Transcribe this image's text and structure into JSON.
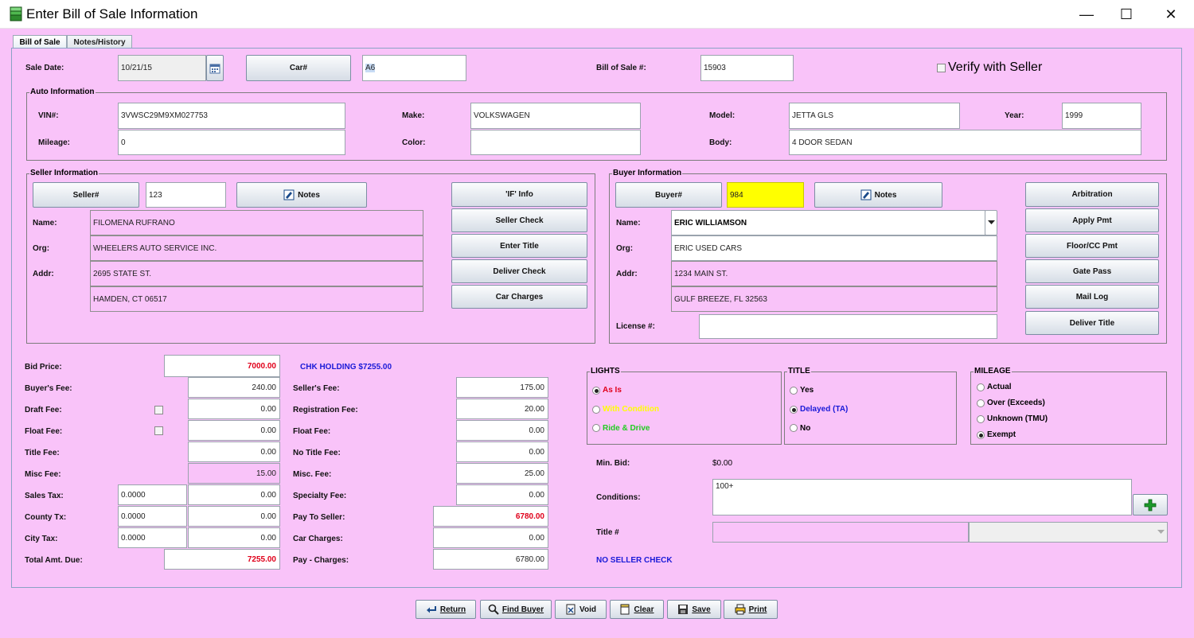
{
  "window": {
    "title": "Enter Bill of Sale Information",
    "minimize": "—",
    "maximize": "☐",
    "close": "✕"
  },
  "tabs": [
    {
      "label": "Bill of Sale"
    },
    {
      "label": "Notes/History"
    }
  ],
  "sale": {
    "date_label": "Sale Date:",
    "date": "10/21/15",
    "car_button": "Car#",
    "car_value": "A6",
    "bos_label": "Bill of Sale #:",
    "bos_value": "15903",
    "verify_label": "Verify with Seller"
  },
  "auto": {
    "title": "Auto Information",
    "vin_label": "VIN#:",
    "vin": "3VWSC29M9XM027753",
    "make_label": "Make:",
    "make": "VOLKSWAGEN",
    "model_label": "Model:",
    "model": "JETTA GLS",
    "year_label": "Year:",
    "year": "1999",
    "mileage_label": "Mileage:",
    "mileage": "0",
    "color_label": "Color:",
    "color": "",
    "body_label": "Body:",
    "body": "4 DOOR SEDAN"
  },
  "seller": {
    "title": "Seller Information",
    "button": "Seller#",
    "number": "123",
    "notes": "Notes",
    "name_label": "Name:",
    "name": "FILOMENA RUFRANO",
    "org_label": "Org:",
    "org": "WHEELERS AUTO SERVICE INC.",
    "addr_label": "Addr:",
    "addr1": "2695 STATE ST.",
    "addr2": "HAMDEN, CT 06517",
    "actions": [
      "'IF' Info",
      "Seller Check",
      "Enter Title",
      "Deliver Check",
      "Car Charges"
    ]
  },
  "buyer": {
    "title": "Buyer Information",
    "button": "Buyer#",
    "number": "984",
    "notes": "Notes",
    "name_label": "Name:",
    "name": "ERIC WILLIAMSON",
    "org_label": "Org:",
    "org": "ERIC USED CARS",
    "addr_label": "Addr:",
    "addr1": "1234 MAIN ST.",
    "addr2": "GULF BREEZE, FL 32563",
    "license_label": "License #:",
    "license": "",
    "actions": [
      "Arbitration",
      "Apply Pmt",
      "Floor/CC Pmt",
      "Gate Pass",
      "Mail Log",
      "Deliver Title"
    ]
  },
  "fees_left": {
    "bid_price_label": "Bid Price:",
    "bid_price": "7000.00",
    "chk_holding": "CHK HOLDING $7255.00",
    "buyers_fee_label": "Buyer's Fee:",
    "buyers_fee": "240.00",
    "draft_fee_label": "Draft Fee:",
    "draft_fee": "0.00",
    "float_fee_label": "Float Fee:",
    "float_fee": "0.00",
    "title_fee_label": "Title Fee:",
    "title_fee": "0.00",
    "misc_fee_label": "Misc Fee:",
    "misc_fee": "15.00",
    "sales_tax_label": "Sales Tax:",
    "sales_tax_rate": "0.0000",
    "sales_tax": "0.00",
    "county_tx_label": "County Tx:",
    "county_tx_rate": "0.0000",
    "county_tx": "0.00",
    "city_tax_label": "City Tax:",
    "city_tax_rate": "0.0000",
    "city_tax": "0.00",
    "total_label": "Total Amt. Due:",
    "total": "7255.00"
  },
  "fees_right": {
    "sellers_fee_label": "Seller's Fee:",
    "sellers_fee": "175.00",
    "reg_fee_label": "Registration Fee:",
    "reg_fee": "20.00",
    "float_fee_label": "Float Fee:",
    "float_fee": "0.00",
    "no_title_label": "No Title Fee:",
    "no_title": "0.00",
    "misc_label": "Misc. Fee:",
    "misc": "25.00",
    "specialty_label": "Specialty Fee:",
    "specialty": "0.00",
    "pay_seller_label": "Pay To Seller:",
    "pay_seller": "6780.00",
    "car_charges_label": "Car Charges:",
    "car_charges": "0.00",
    "pay_charges_label": "Pay - Charges:",
    "pay_charges": "6780.00"
  },
  "lights": {
    "title": "LIGHTS",
    "options": [
      "As Is",
      "With Condition",
      "Ride & Drive"
    ],
    "selected": 0,
    "colors": [
      "#e0001a",
      "#ffff00",
      "#22cc22"
    ]
  },
  "title_status": {
    "title": "TITLE",
    "options": [
      "Yes",
      "Delayed (TA)",
      "No"
    ],
    "selected": 1
  },
  "mileage_status": {
    "title": "MILEAGE",
    "options": [
      "Actual",
      "Over (Exceeds)",
      "Unknown (TMU)",
      "Exempt"
    ],
    "selected": 3
  },
  "misc": {
    "min_bid_label": "Min. Bid:",
    "min_bid": "$0.00",
    "conditions_label": "Conditions:",
    "conditions": "100+",
    "title_no_label": "Title #",
    "no_seller_check": "NO SELLER CHECK"
  },
  "footer": {
    "return": "Return",
    "find_buyer": "Find Buyer",
    "void": "Void",
    "clear": "Clear",
    "save": "Save",
    "print": "Print"
  }
}
